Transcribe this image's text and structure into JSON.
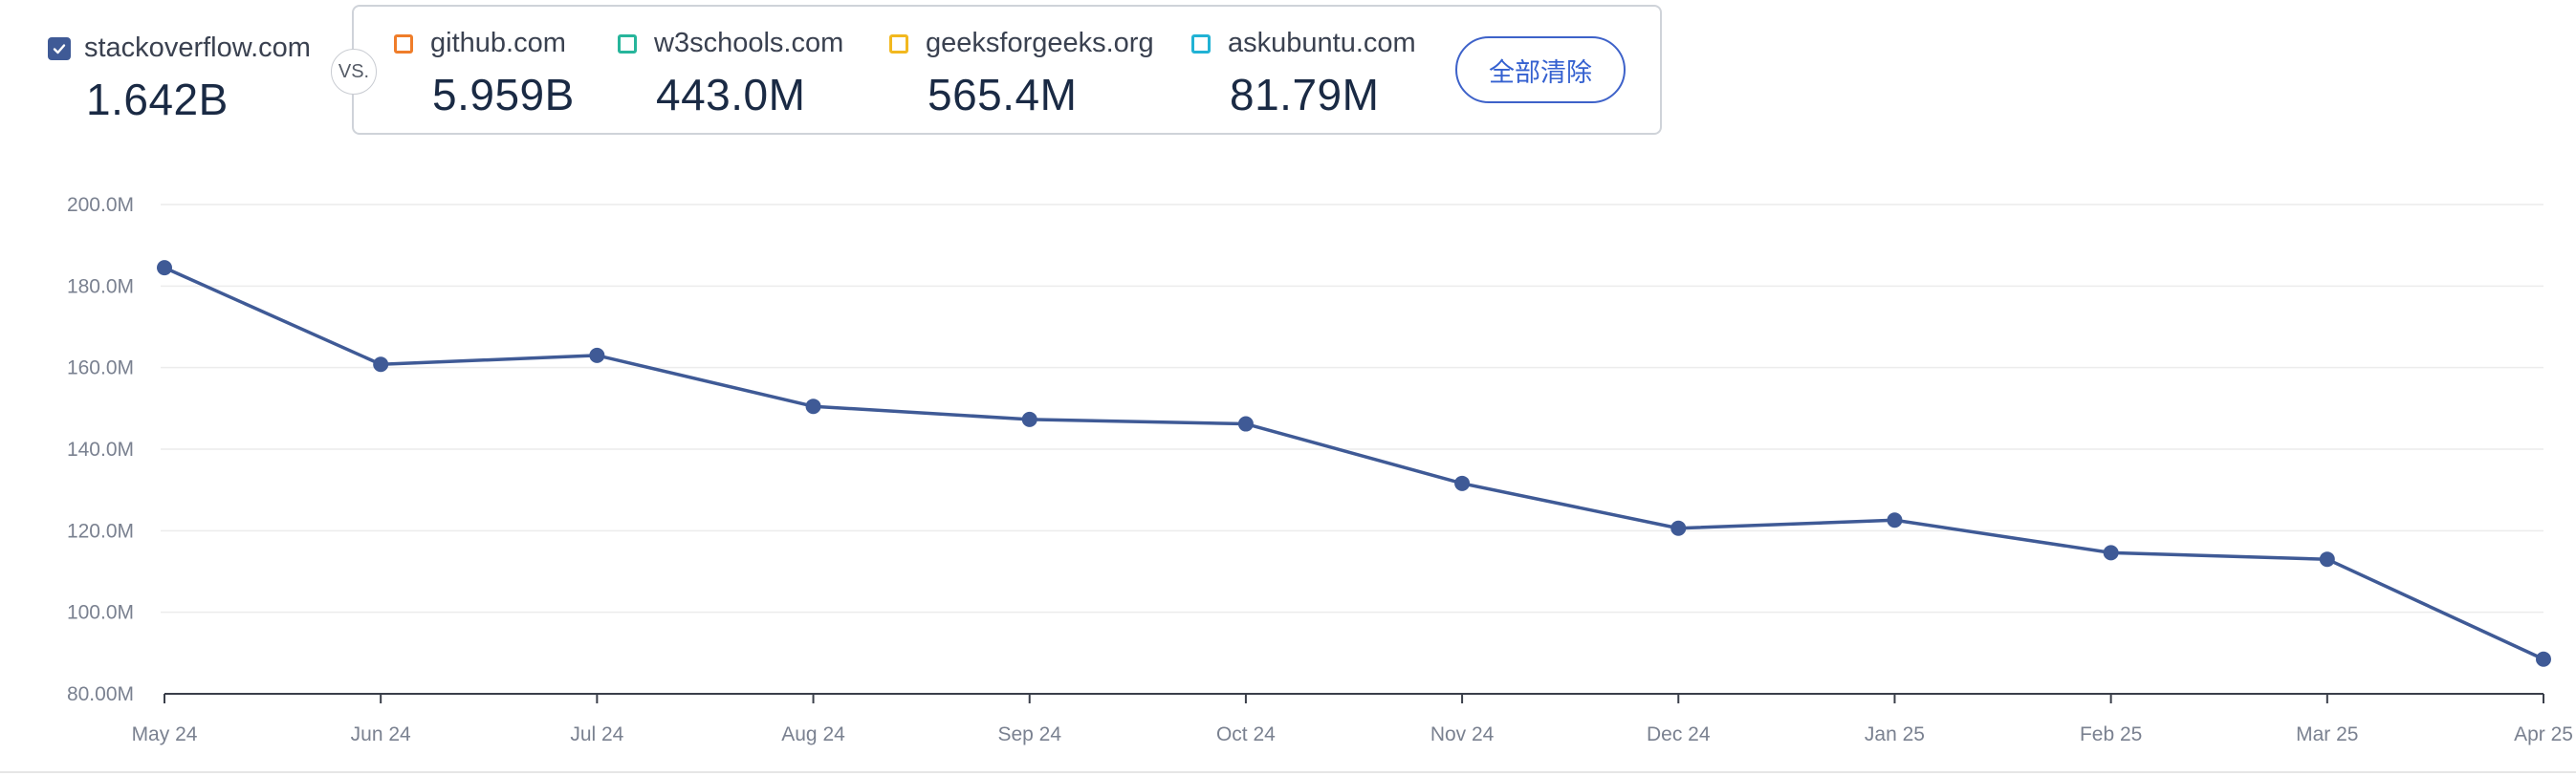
{
  "primary_site": {
    "name": "stackoverflow.com",
    "value": "1.642B",
    "color": "#3f5a96",
    "checked": true
  },
  "vs_label": "VS.",
  "competitors": [
    {
      "name": "github.com",
      "value": "5.959B",
      "color": "#ef7d2a"
    },
    {
      "name": "w3schools.com",
      "value": "443.0M",
      "color": "#27b59b"
    },
    {
      "name": "geeksforgeeks.org",
      "value": "565.4M",
      "color": "#f2b81f"
    },
    {
      "name": "askubuntu.com",
      "value": "81.79M",
      "color": "#21b2d4"
    }
  ],
  "clear_button": "全部清除",
  "chart_data": {
    "type": "line",
    "x": [
      "May 24",
      "Jun 24",
      "Jul 24",
      "Aug 24",
      "Sep 24",
      "Oct 24",
      "Nov 24",
      "Dec 24",
      "Jan 25",
      "Feb 25",
      "Mar 25",
      "Apr 25"
    ],
    "series": [
      {
        "values": [
          184.5,
          160.8,
          163.0,
          150.5,
          147.3,
          146.2,
          131.6,
          120.6,
          122.6,
          114.6,
          113.0,
          88.5
        ],
        "color": "#3f5a96"
      }
    ],
    "yticks": [
      "200.0M",
      "180.0M",
      "160.0M",
      "140.0M",
      "120.0M",
      "100.0M",
      "80.00M"
    ],
    "ylim": [
      80,
      200
    ],
    "grid": true
  }
}
